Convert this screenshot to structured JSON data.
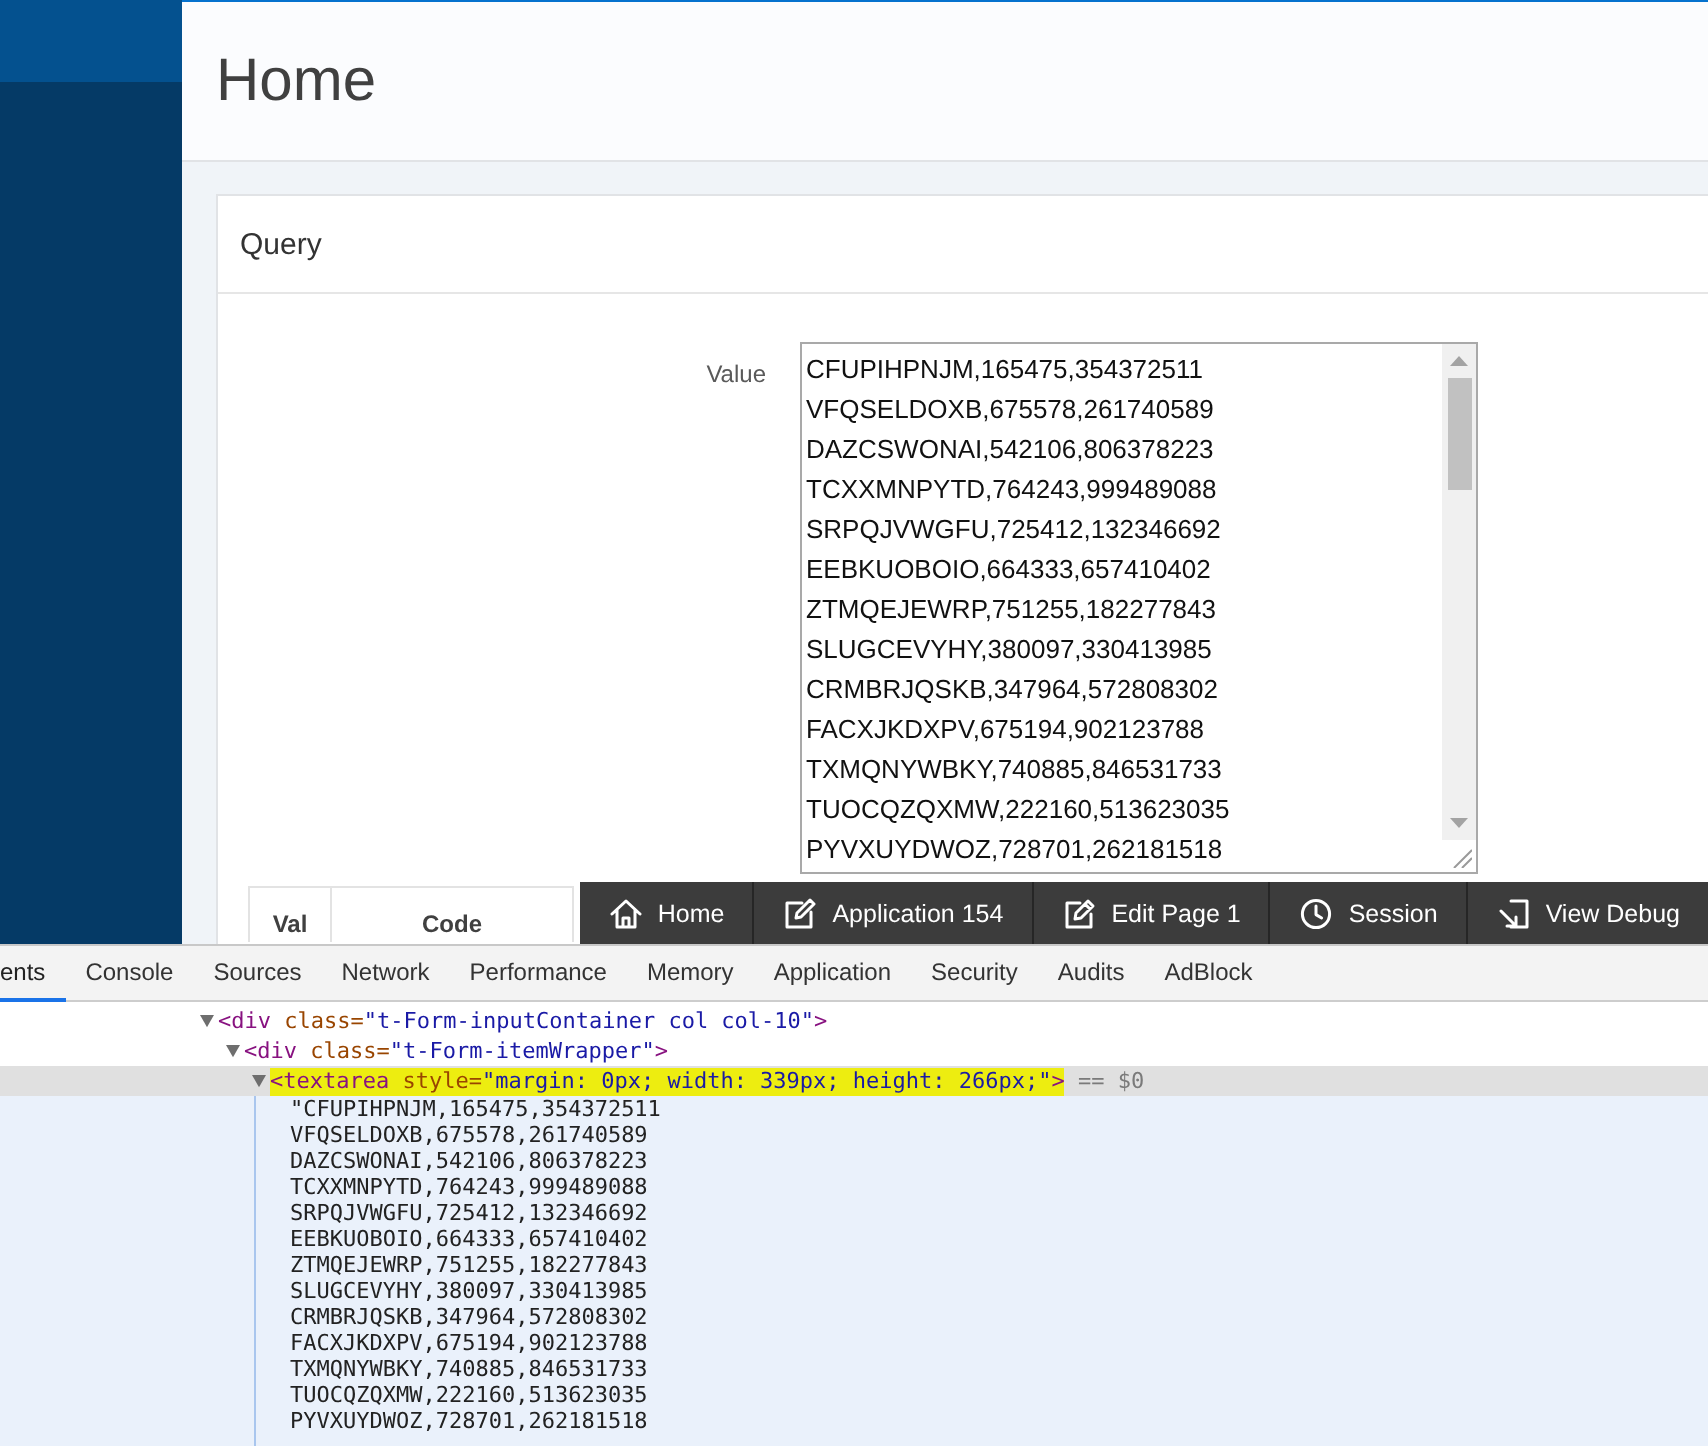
{
  "page": {
    "title": "Home"
  },
  "region": {
    "title": "Query",
    "field": {
      "label": "Value",
      "value_lines": [
        "CFUPIHPNJM,165475,354372511",
        "VFQSELDOXB,675578,261740589",
        "DAZCSWONAI,542106,806378223",
        "TCXXMNPYTD,764243,999489088",
        "SRPQJVWGFU,725412,132346692",
        "EEBKUOBOIO,664333,657410402",
        "ZTMQEJEWRP,751255,182277843",
        "SLUGCEVYHY,380097,330413985",
        "CRMBRJQSKB,347964,572808302",
        "FACXJKDXPV,675194,902123788",
        "TXMQNYWBKY,740885,846531733",
        "TUOCQZQXMW,222160,513623035",
        "PYVXUYDWOZ,728701,262181518"
      ]
    },
    "table": {
      "columns": [
        "Val",
        "Code"
      ]
    }
  },
  "developer_toolbar": {
    "buttons": [
      {
        "label": "Home"
      },
      {
        "label": "Application 154"
      },
      {
        "label": "Edit Page 1"
      },
      {
        "label": "Session"
      },
      {
        "label": "View Debug"
      }
    ]
  },
  "devtools": {
    "tabs": [
      {
        "label": "ents",
        "selected": true
      },
      {
        "label": "Console",
        "selected": false
      },
      {
        "label": "Sources",
        "selected": false
      },
      {
        "label": "Network",
        "selected": false
      },
      {
        "label": "Performance",
        "selected": false
      },
      {
        "label": "Memory",
        "selected": false
      },
      {
        "label": "Application",
        "selected": false
      },
      {
        "label": "Security",
        "selected": false
      },
      {
        "label": "Audits",
        "selected": false
      },
      {
        "label": "AdBlock",
        "selected": false
      }
    ],
    "dom_tree": [
      {
        "kind": "element",
        "expanded": true,
        "selected": false,
        "highlighted": false,
        "parts": [
          {
            "kind": "tag",
            "text": "<div "
          },
          {
            "kind": "attr",
            "text": "class="
          },
          {
            "kind": "value",
            "text": "\"t-Form-inputContainer col col-10\""
          },
          {
            "kind": "tag",
            "text": ">"
          }
        ],
        "children": [
          {
            "kind": "element",
            "expanded": true,
            "selected": false,
            "highlighted": false,
            "parts": [
              {
                "kind": "tag",
                "text": "<div "
              },
              {
                "kind": "attr",
                "text": "class="
              },
              {
                "kind": "value",
                "text": "\"t-Form-itemWrapper\""
              },
              {
                "kind": "tag",
                "text": ">"
              }
            ],
            "children": [
              {
                "kind": "element",
                "expanded": true,
                "selected": true,
                "highlighted": true,
                "parts": [
                  {
                    "kind": "tag",
                    "text": "<textarea "
                  },
                  {
                    "kind": "attr",
                    "text": "style="
                  },
                  {
                    "kind": "value",
                    "text": "\"margin: 0px; width: 339px; height: 266px;\""
                  },
                  {
                    "kind": "tag",
                    "text": ">"
                  }
                ],
                "suffix": "== $0",
                "children": [
                  {
                    "kind": "text",
                    "selected": false,
                    "lines": [
                      "\"CFUPIHPNJM,165475,354372511",
                      "VFQSELDOXB,675578,261740589",
                      "DAZCSWONAI,542106,806378223",
                      "TCXXMNPYTD,764243,999489088",
                      "SRPQJVWGFU,725412,132346692",
                      "EEBKUOBOIO,664333,657410402",
                      "ZTMQEJEWRP,751255,182277843",
                      "SLUGCEVYHY,380097,330413985",
                      "CRMBRJQSKB,347964,572808302",
                      "FACXJKDXPV,675194,902123788",
                      "TXMQNYWBKY,740885,846531733",
                      "TUOCQZQXMW,222160,513623035",
                      "PYVXUYDWOZ,728701,262181518"
                    ]
                  }
                ]
              }
            ]
          }
        ]
      }
    ]
  }
}
